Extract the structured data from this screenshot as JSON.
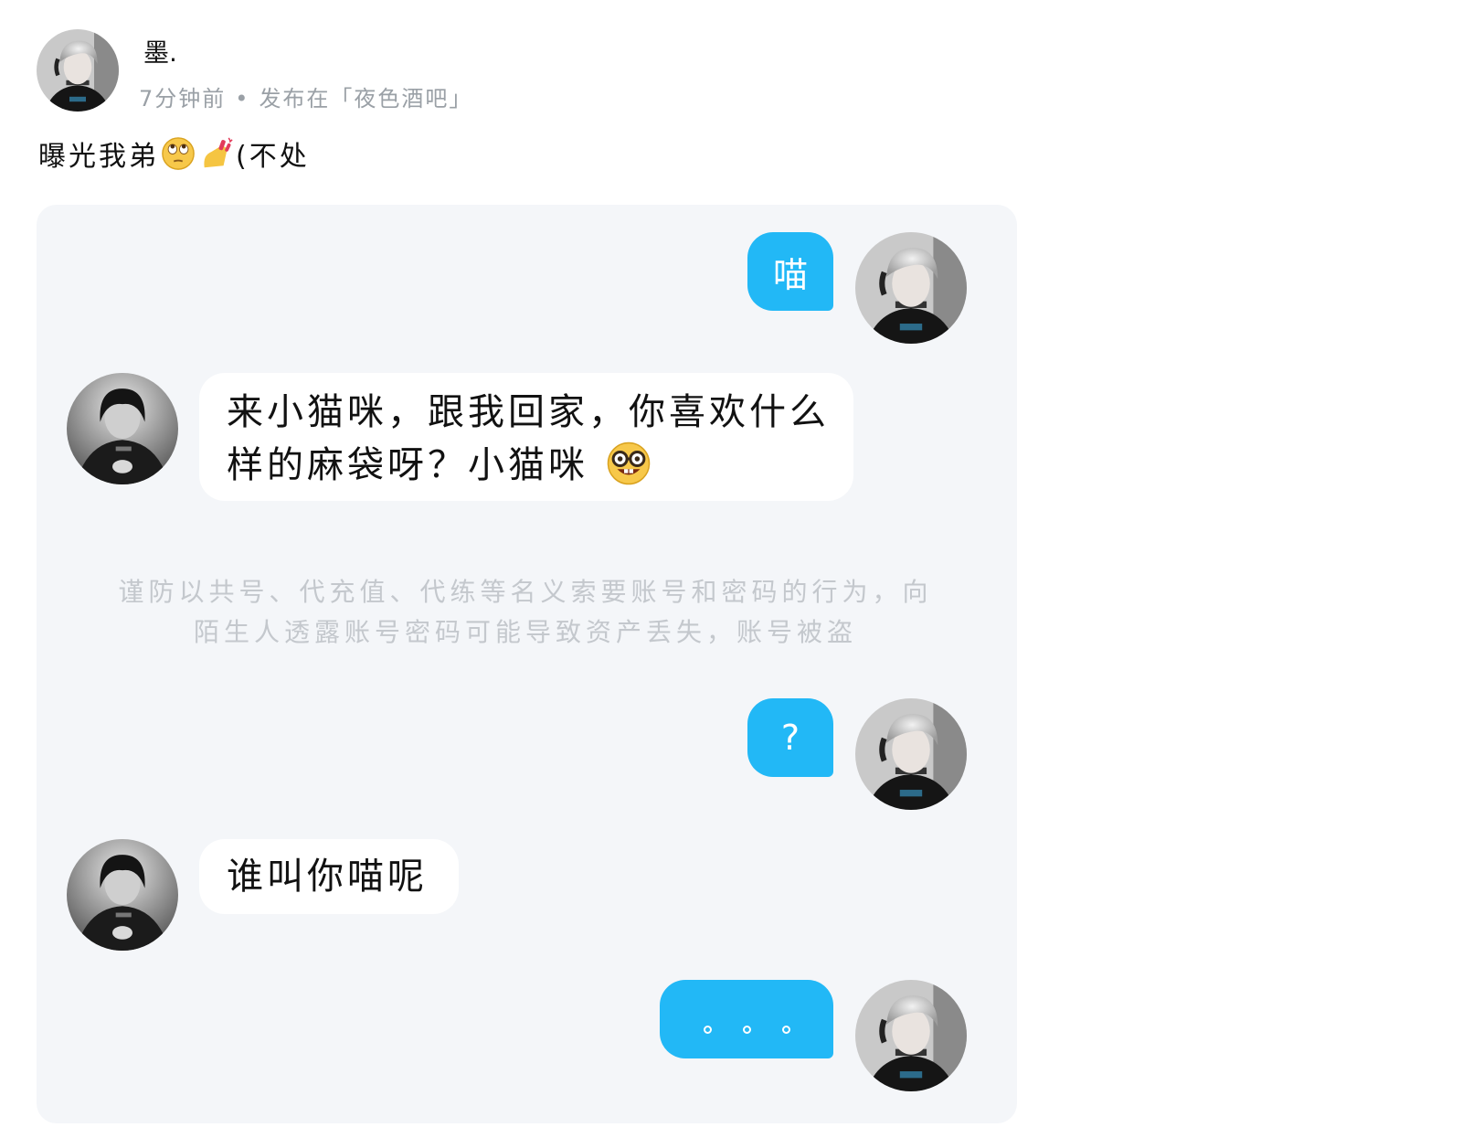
{
  "post": {
    "username": "墨.",
    "time": "7分钟前",
    "separator": "•",
    "posted_in": "发布在「夜色酒吧」",
    "text_before": "曝光我弟",
    "text_after": "(不处",
    "emojis": [
      "face-with-rolling-eyes-icon",
      "nail-polish-icon"
    ]
  },
  "chat": {
    "warning": "谨防以共号、代充值、代练等名义索要账号和密码的行为，向陌生人透露账号密码可能导致资产丢失，账号被盗",
    "messages": [
      {
        "side": "right",
        "text": "喵"
      },
      {
        "side": "left",
        "text": "来小猫咪，跟我回家，你喜欢什么样的麻袋呀？小猫咪",
        "emoji": "nerd-face-icon"
      },
      {
        "side": "right",
        "text": "?"
      },
      {
        "side": "left",
        "text": "谁叫你喵呢"
      },
      {
        "side": "right",
        "text": "。。。"
      }
    ]
  },
  "colors": {
    "outgoing_bubble": "#22b8f6",
    "incoming_bubble": "#ffffff",
    "card_background": "#f4f6f9",
    "meta_text": "#9aa0a6",
    "warning_text": "#c4c8cd"
  }
}
